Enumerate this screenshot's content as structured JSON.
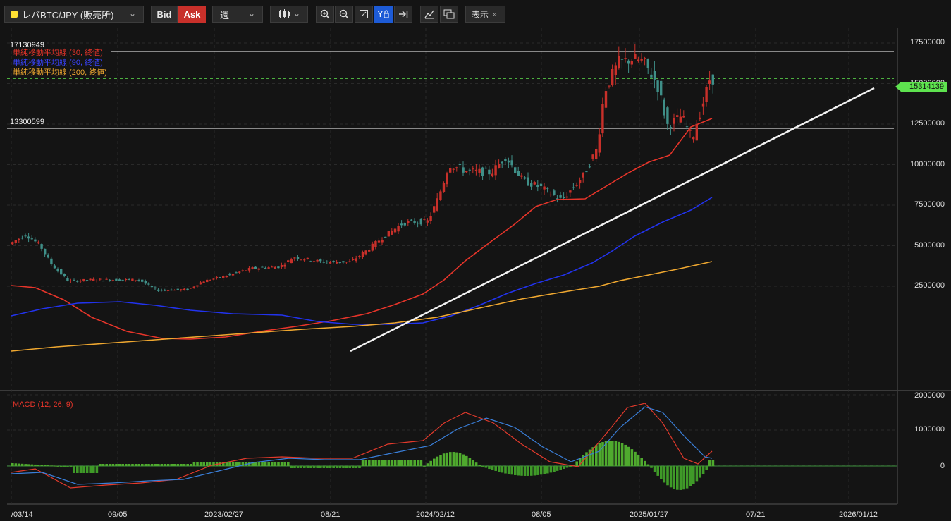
{
  "toolbar": {
    "symbol": "レバBTC/JPY (販売所)",
    "bid_label": "Bid",
    "ask_label": "Ask",
    "period": "週",
    "display_label": "表示",
    "chevron": "⌄"
  },
  "price_axis": [
    "17500000",
    "15000000",
    "12500000",
    "10000000",
    "7500000",
    "5000000",
    "2500000"
  ],
  "current_price": "15314139",
  "hlines": {
    "upper": "17130949",
    "lower": "13300599"
  },
  "legend": {
    "ma30": "単純移動平均線 (30, 終値)",
    "ma90": "単純移動平均線 (90, 終値)",
    "ma200": "単純移動平均線 (200, 終値)"
  },
  "macd": {
    "label": "MACD (12, 26, 9)",
    "axis": [
      "2000000",
      "1000000",
      "0"
    ]
  },
  "time_axis": [
    "/03/14",
    "09/05",
    "2023/02/27",
    "08/21",
    "2024/02/12",
    "08/05",
    "2025/01/27",
    "07/21",
    "2026/01/12"
  ],
  "colors": {
    "up": "#c8302a",
    "down": "#3f8f88",
    "ma30": "#e8352a",
    "ma90": "#2233ee",
    "ma200": "#f0a830",
    "accent": "#1d5bd6",
    "price_tag": "#5ee34f"
  }
}
